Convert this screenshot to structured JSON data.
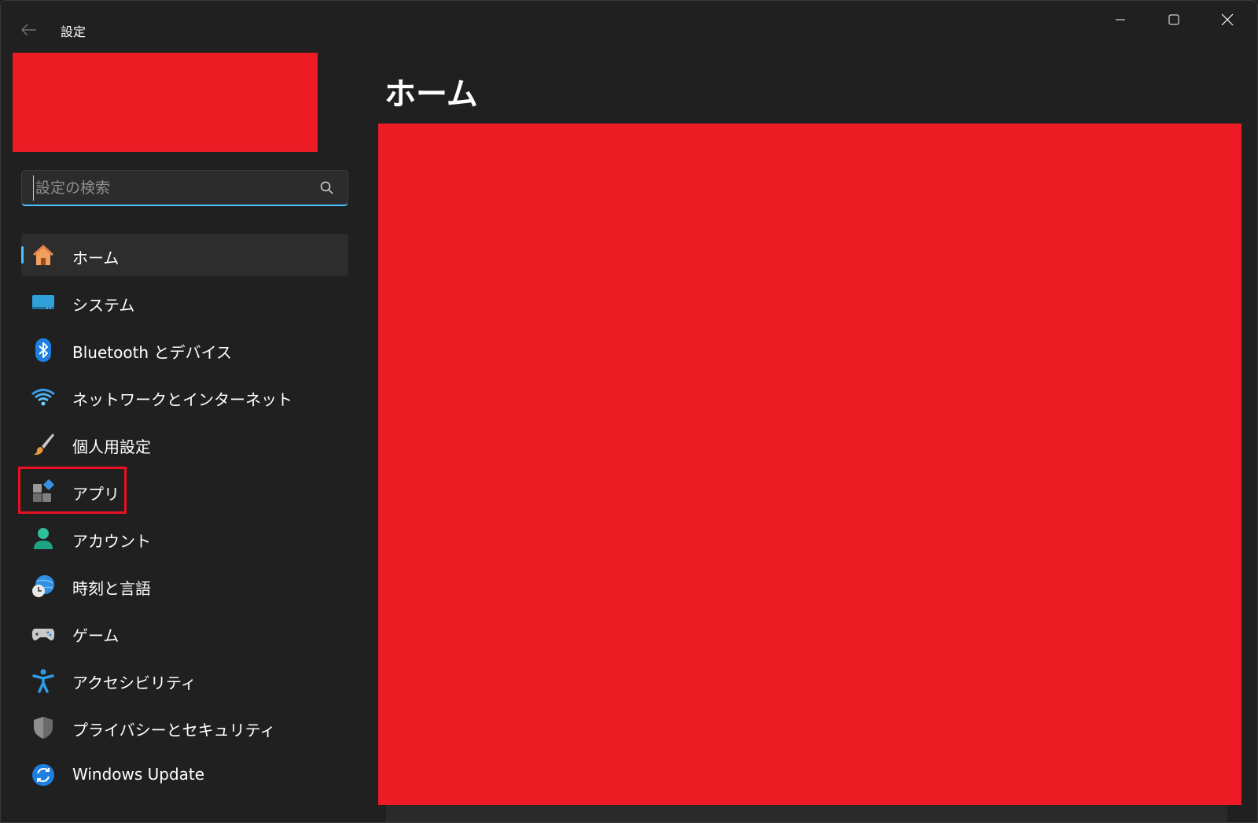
{
  "titlebar": {
    "app_title": "設定",
    "back_icon": "arrow-left-icon",
    "controls": [
      "minimize-icon",
      "maximize-icon",
      "close-icon"
    ]
  },
  "search": {
    "placeholder": "設定の検索",
    "value": "",
    "icon": "search-icon",
    "accent_color": "#4cc2ff"
  },
  "sidebar": {
    "items": [
      {
        "label": "ホーム",
        "icon": "home-icon",
        "selected": true
      },
      {
        "label": "システム",
        "icon": "monitor-icon",
        "selected": false
      },
      {
        "label": "Bluetooth とデバイス",
        "icon": "bluetooth-icon",
        "selected": false
      },
      {
        "label": "ネットワークとインターネット",
        "icon": "wifi-icon",
        "selected": false
      },
      {
        "label": "個人用設定",
        "icon": "paintbrush-icon",
        "selected": false
      },
      {
        "label": "アプリ",
        "icon": "apps-icon",
        "selected": false,
        "highlighted": true
      },
      {
        "label": "アカウント",
        "icon": "person-icon",
        "selected": false
      },
      {
        "label": "時刻と言語",
        "icon": "globe-clock-icon",
        "selected": false
      },
      {
        "label": "ゲーム",
        "icon": "gamepad-icon",
        "selected": false
      },
      {
        "label": "アクセシビリティ",
        "icon": "accessibility-icon",
        "selected": false
      },
      {
        "label": "プライバシーとセキュリティ",
        "icon": "shield-icon",
        "selected": false
      },
      {
        "label": "Windows Update",
        "icon": "update-icon",
        "selected": false
      }
    ]
  },
  "main": {
    "title": "ホーム"
  },
  "colors": {
    "background": "#202020",
    "accent": "#4cc2ff",
    "redaction": "#ed1c24",
    "highlight_border": "#e81123"
  }
}
